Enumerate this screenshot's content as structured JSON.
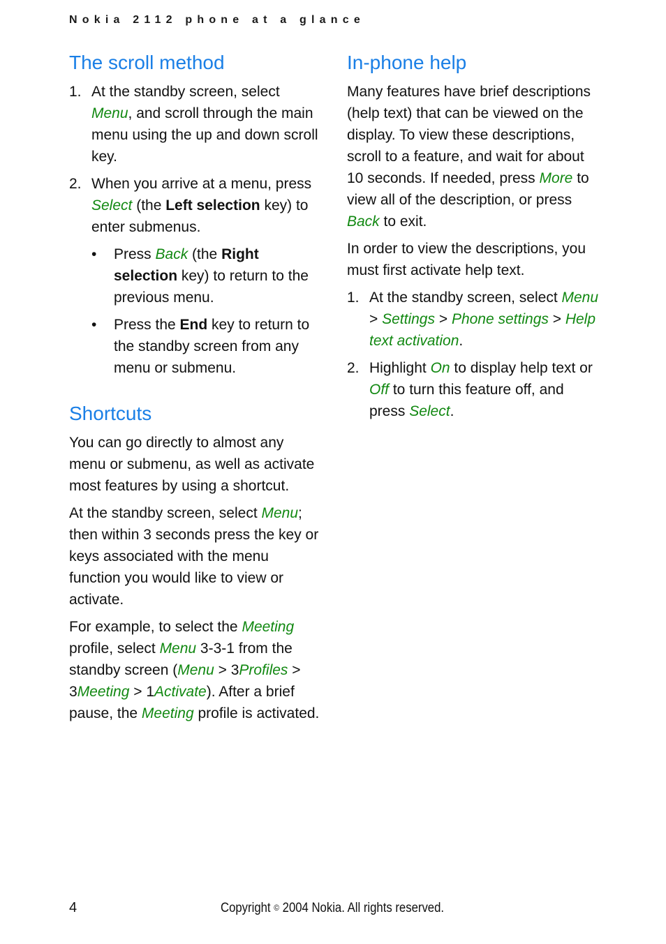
{
  "header": {
    "running_title": "Nokia 2112 phone at a glance"
  },
  "left_column": {
    "scroll_method": {
      "title": "The scroll method",
      "steps": [
        {
          "num": "1.",
          "parts": [
            "At the standby screen, select ",
            "Menu",
            ", and scroll through the main menu using the up and down scroll key."
          ]
        },
        {
          "num": "2.",
          "parts": [
            "When you arrive at a menu, press ",
            "Select",
            " (the ",
            "Left selection",
            " key) to enter submenus."
          ]
        }
      ],
      "bullets": [
        {
          "dot": "•",
          "parts": [
            "Press ",
            "Back",
            " (the ",
            "Right selection",
            " key) to return to the previous menu."
          ]
        },
        {
          "dot": "•",
          "parts": [
            "Press the ",
            "End",
            " key to return to the standby screen from any menu or submenu."
          ]
        }
      ]
    },
    "shortcuts": {
      "title": "Shortcuts",
      "para1": "You can go directly to almost any menu or submenu, as well as activate most features by using a shortcut.",
      "para2": [
        "At the standby screen, select ",
        "Menu",
        "; then within 3 seconds press the key or keys associated with the menu function you would like to view or activate."
      ],
      "para3": [
        "For example, to select the ",
        "Meeting",
        " profile, select ",
        "Menu",
        " 3-3-1 from the standby screen (",
        "Menu",
        " > 3",
        "Profiles",
        " > 3",
        "Meeting",
        " > 1",
        "Activate",
        "). After a brief pause, the ",
        "Meeting",
        " profile is activated."
      ]
    }
  },
  "right_column": {
    "in_phone_help": {
      "title": "In-phone help",
      "para1": [
        "Many features have brief descriptions (help text) that can be viewed on the display. To view these descriptions, scroll to a feature, and wait for about 10 seconds. If needed, press ",
        "More",
        " to view all of the description, or press ",
        "Back",
        " to exit."
      ],
      "para2": "In order to view the descriptions, you must first activate help text.",
      "steps": [
        {
          "num": "1.",
          "parts": [
            "At the standby screen, select ",
            "Menu",
            " > ",
            "Settings",
            " > ",
            "Phone settings",
            " > ",
            "Help text activation",
            "."
          ]
        },
        {
          "num": "2.",
          "parts": [
            "Highlight ",
            "On",
            " to display help text or ",
            "Off",
            " to turn this feature off, and press ",
            "Select",
            "."
          ]
        }
      ]
    }
  },
  "footer": {
    "page_number": "4",
    "copyright_prefix": "Copyright ",
    "copyright_symbol": "©",
    "copyright_suffix": " 2004 Nokia. All rights reserved."
  },
  "colors": {
    "heading": "#1a7fe6",
    "emphasis": "#118811",
    "text": "#111111"
  }
}
